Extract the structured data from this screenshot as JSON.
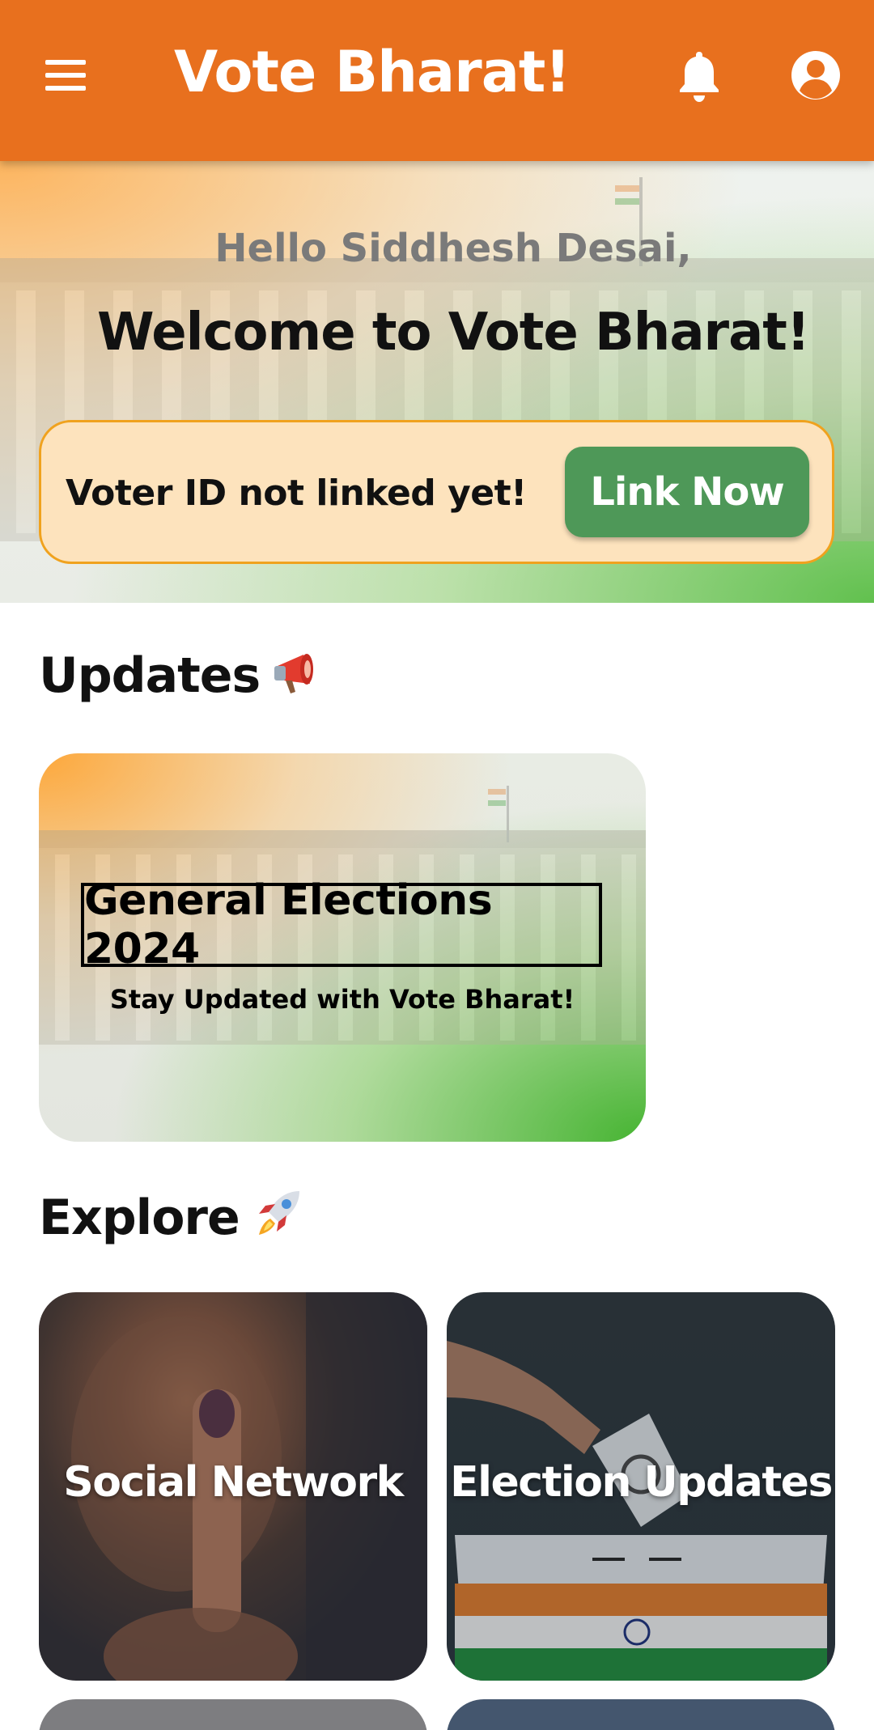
{
  "app_bar": {
    "title": "Vote Bharat!",
    "background_color": "#E8701E",
    "icons": [
      "menu-icon",
      "bell-icon",
      "account-circle-icon"
    ]
  },
  "hero": {
    "greeting": "Hello Siddhesh Desai,",
    "welcome": "Welcome to Vote Bharat!",
    "voter_card": {
      "message": "Voter ID not linked yet!",
      "button_label": "Link Now",
      "button_color": "#4E9858"
    }
  },
  "updates": {
    "title": "Updates",
    "title_icon": "megaphone-icon",
    "cards": [
      {
        "headline": "General Elections 2024",
        "subtitle": "Stay Updated with Vote Bharat!"
      }
    ]
  },
  "explore": {
    "title": "Explore",
    "title_icon": "rocket-icon",
    "tiles": [
      {
        "label": "Social Network"
      },
      {
        "label": "Election Updates"
      }
    ]
  }
}
